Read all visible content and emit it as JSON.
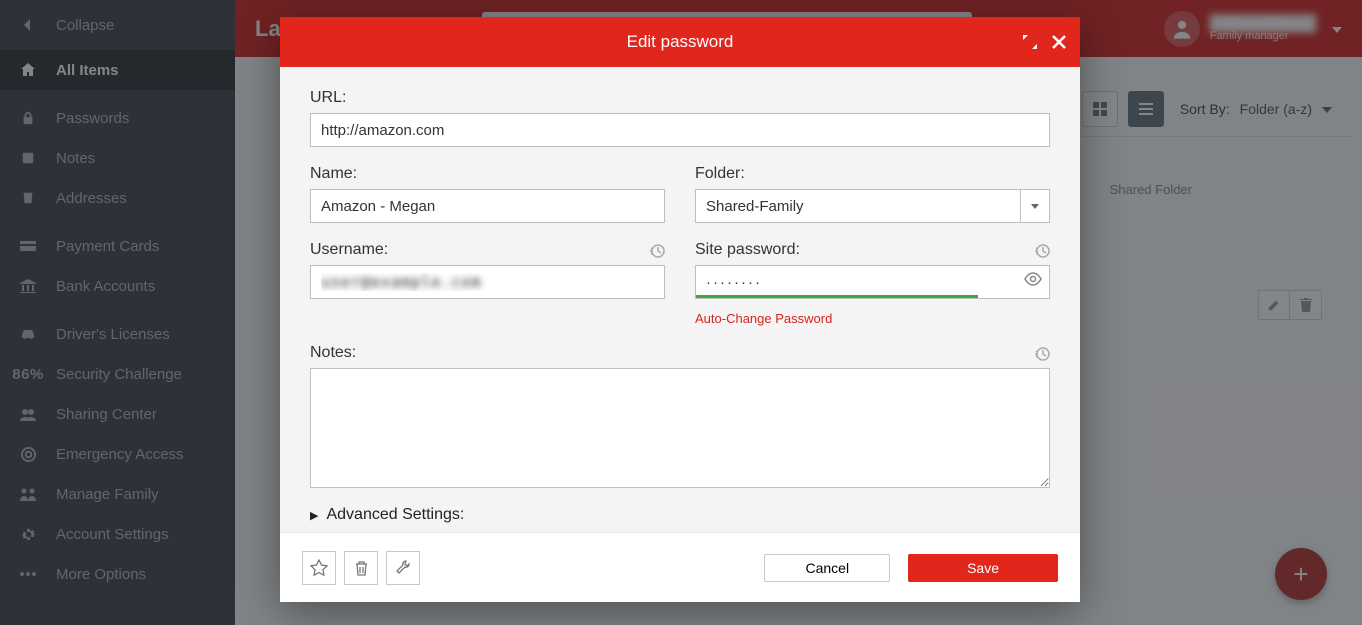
{
  "sidebar": {
    "collapse": "Collapse",
    "items": [
      {
        "label": "All Items"
      },
      {
        "label": "Passwords"
      },
      {
        "label": "Notes"
      },
      {
        "label": "Addresses"
      },
      {
        "label": "Payment Cards"
      },
      {
        "label": "Bank Accounts"
      },
      {
        "label": "Driver's Licenses"
      },
      {
        "label": "Security Challenge",
        "pct": "86%"
      },
      {
        "label": "Sharing Center"
      },
      {
        "label": "Emergency Access"
      },
      {
        "label": "Manage Family"
      },
      {
        "label": "Account Settings"
      },
      {
        "label": "More Options"
      }
    ]
  },
  "header": {
    "logo": "LastPass",
    "user_name": "██████████",
    "user_role": "Family manager"
  },
  "content": {
    "sort_label": "Sort By:",
    "sort_value": "Folder (a-z)",
    "shared_folder": "Shared Folder"
  },
  "modal": {
    "title": "Edit password",
    "url_label": "URL:",
    "url_value": "http://amazon.com",
    "name_label": "Name:",
    "name_value": "Amazon - Megan",
    "folder_label": "Folder:",
    "folder_value": "Shared-Family",
    "username_label": "Username:",
    "username_value": "user@example.com",
    "password_label": "Site password:",
    "password_value": "········",
    "auto_change": "Auto-Change Password",
    "notes_label": "Notes:",
    "notes_value": "",
    "advanced": "Advanced Settings:",
    "cancel": "Cancel",
    "save": "Save"
  }
}
